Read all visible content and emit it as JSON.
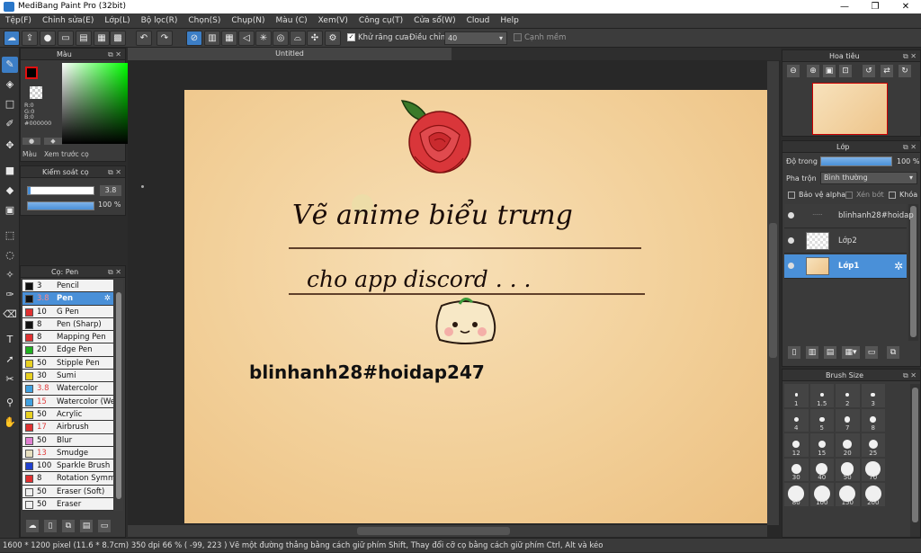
{
  "window": {
    "title": "MediBang Paint Pro (32bit)",
    "minimize": "—",
    "maximize": "❐",
    "close": "✕"
  },
  "menu": [
    "Tệp(F)",
    "Chỉnh sửa(E)",
    "Lớp(L)",
    "Bộ lọc(R)",
    "Chọn(S)",
    "Chụp(N)",
    "Màu (C)",
    "Xem(V)",
    "Công cụ(T)",
    "Cửa sổ(W)",
    "Cloud",
    "Help"
  ],
  "toolbar": {
    "antialias_label": "Khử răng cưa",
    "adjust_label": "Điều chỉnh",
    "adjust_value": "40",
    "snap_label": "Cạnh mềm"
  },
  "color_panel": {
    "title": "Màu",
    "r": "R:0",
    "g": "G:0",
    "b": "B:0",
    "hex": "#000000",
    "tab1": "Màu",
    "tab2": "Xem trước cọ"
  },
  "brush_control": {
    "title": "Kiểm soát cọ",
    "size": "3.8",
    "opacity": "100 %"
  },
  "brush_panel": {
    "title": "Cọ: Pen",
    "items": [
      {
        "size": "3",
        "name": "Pencil",
        "color": "#111111"
      },
      {
        "size": "3.8",
        "name": "Pen",
        "color": "#111111"
      },
      {
        "size": "10",
        "name": "G Pen",
        "color": "#e03030"
      },
      {
        "size": "8",
        "name": "Pen (Sharp)",
        "color": "#111111"
      },
      {
        "size": "8",
        "name": "Mapping Pen",
        "color": "#e03030"
      },
      {
        "size": "20",
        "name": "Edge Pen",
        "color": "#20b020"
      },
      {
        "size": "50",
        "name": "Stipple Pen",
        "color": "#e8d020"
      },
      {
        "size": "30",
        "name": "Sumi",
        "color": "#e8d020"
      },
      {
        "size": "3.8",
        "name": "Watercolor",
        "color": "#40a0e0"
      },
      {
        "size": "15",
        "name": "Watercolor (Wet)",
        "color": "#40a0e0"
      },
      {
        "size": "50",
        "name": "Acrylic",
        "color": "#e8d020"
      },
      {
        "size": "17",
        "name": "Airbrush",
        "color": "#e03030"
      },
      {
        "size": "50",
        "name": "Blur",
        "color": "#e080d0"
      },
      {
        "size": "13",
        "name": "Smudge",
        "color": "#e8e0c0"
      },
      {
        "size": "100",
        "name": "Sparkle Brush",
        "color": "#2040d0"
      },
      {
        "size": "8",
        "name": "Rotation Symmetry",
        "color": "#e03030"
      },
      {
        "size": "50",
        "name": "Eraser (Soft)",
        "color": "#f0f0f0"
      },
      {
        "size": "50",
        "name": "Eraser",
        "color": "#f0f0f0"
      }
    ]
  },
  "canvas": {
    "tab": "Untitled",
    "line1": "Vẽ anime biểu trưng",
    "line2": "cho app discord . . .",
    "signature": "blinhanh28#hoidap247"
  },
  "navigator": {
    "title": "Hoa tiêu"
  },
  "layer_panel": {
    "title": "Lớp",
    "opacity_label": "Độ trong",
    "opacity_value": "100 %",
    "blend_label": "Pha trộn",
    "blend_value": "Bình thường",
    "protect_alpha": "Bảo vệ alpha",
    "clipping": "Xén bớt",
    "lock": "Khóa",
    "layers": [
      {
        "name": "blinhanh28#hoidap"
      },
      {
        "name": "Lớp2"
      },
      {
        "name": "Lớp1"
      }
    ]
  },
  "brush_size": {
    "title": "Brush Size",
    "sizes": [
      "1",
      "1.5",
      "2",
      "3",
      "4",
      "5",
      "7",
      "8",
      "12",
      "15",
      "20",
      "25",
      "30",
      "40",
      "50",
      "70",
      "80",
      "100",
      "150",
      "200"
    ]
  },
  "statusbar": {
    "text": "1600 * 1200 pixel   (11.6 * 8.7cm)   350 dpi   66 %   ( -99, 223 )   Vẽ một đường thẳng bằng cách giữ phím Shift, Thay đổi cỡ cọ bằng cách giữ phím Ctrl, Alt và kéo"
  }
}
